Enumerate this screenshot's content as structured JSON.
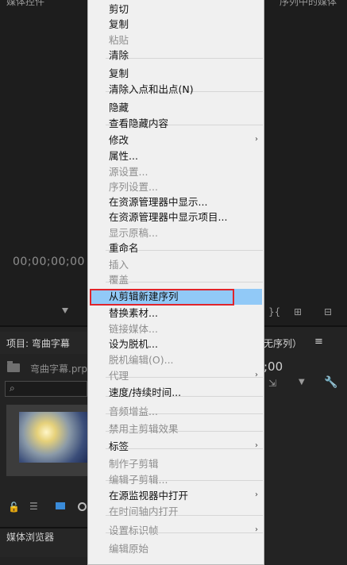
{
  "background": {
    "top_left_text": "媒体控件",
    "top_right_text": "序列中的媒体",
    "timecode": "00;00;00;00",
    "project_panel_title": "项目: 弯曲字幕",
    "sequence_title": "无序列）",
    "sequence_menu": "≡",
    "sequence_timecode": ";00",
    "project_file": "弯曲字幕.prp",
    "media_browser": "媒体浏览器"
  },
  "menu": {
    "items": [
      {
        "label": "剪切",
        "disabled": false
      },
      {
        "label": "复制",
        "disabled": false
      },
      {
        "label": "粘贴",
        "disabled": true
      },
      {
        "label": "清除",
        "disabled": false
      },
      {
        "label": "复制",
        "disabled": false
      },
      {
        "label": "清除入点和出点(N)",
        "disabled": false
      },
      {
        "label": "隐藏",
        "disabled": false
      },
      {
        "label": "查看隐藏内容",
        "disabled": false
      },
      {
        "label": "修改",
        "disabled": false,
        "submenu": true
      },
      {
        "label": "属性...",
        "disabled": false
      },
      {
        "label": "源设置...",
        "disabled": true
      },
      {
        "label": "序列设置...",
        "disabled": true
      },
      {
        "label": "在资源管理器中显示...",
        "disabled": false
      },
      {
        "label": "在资源管理器中显示项目...",
        "disabled": false
      },
      {
        "label": "显示原稿...",
        "disabled": true
      },
      {
        "label": "重命名",
        "disabled": false
      },
      {
        "label": "插入",
        "disabled": true
      },
      {
        "label": "覆盖",
        "disabled": true
      },
      {
        "label": "从剪辑新建序列",
        "disabled": false,
        "highlighted": true
      },
      {
        "label": "替换素材...",
        "disabled": false
      },
      {
        "label": "链接媒体...",
        "disabled": true
      },
      {
        "label": "设为脱机...",
        "disabled": false
      },
      {
        "label": "脱机编辑(O)...",
        "disabled": true
      },
      {
        "label": "代理",
        "disabled": true,
        "submenu": true
      },
      {
        "label": "速度/持续时间...",
        "disabled": false
      },
      {
        "label": "音频增益...",
        "disabled": true
      },
      {
        "label": "禁用主剪辑效果",
        "disabled": true
      },
      {
        "label": "标签",
        "disabled": false,
        "submenu": true
      },
      {
        "label": "制作子剪辑",
        "disabled": true
      },
      {
        "label": "编辑子剪辑...",
        "disabled": true
      },
      {
        "label": "在源监视器中打开",
        "disabled": false,
        "submenu": true
      },
      {
        "label": "在时间轴内打开",
        "disabled": true
      },
      {
        "label": "设置标识帧",
        "disabled": true,
        "submenu": true
      },
      {
        "label": "编辑原始",
        "disabled": true
      }
    ],
    "colors": {
      "highlight": "#91c9f7",
      "annotation_box": "#e0242b"
    }
  }
}
